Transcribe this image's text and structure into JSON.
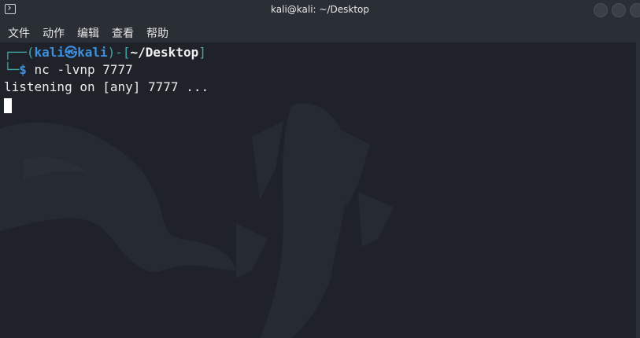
{
  "window": {
    "title": "kali@kali: ~/Desktop",
    "icon": "terminal-icon"
  },
  "menu": {
    "items": [
      "文件",
      "动作",
      "编辑",
      "查看",
      "帮助"
    ]
  },
  "prompt": {
    "corner_top": "┌──(",
    "user": "kali",
    "separator": "㉿",
    "host": "kali",
    "bracket_mid": ")-[",
    "path": "~/Desktop",
    "bracket_end": "]",
    "corner_bottom": "└─",
    "dollar": "$",
    "command": " nc -lvnp 7777"
  },
  "output": {
    "line1": "listening on [any] 7777 ..."
  },
  "colors": {
    "accent_teal": "#3fa7a8",
    "accent_blue": "#3d8fe0",
    "background": "#1f2329"
  }
}
